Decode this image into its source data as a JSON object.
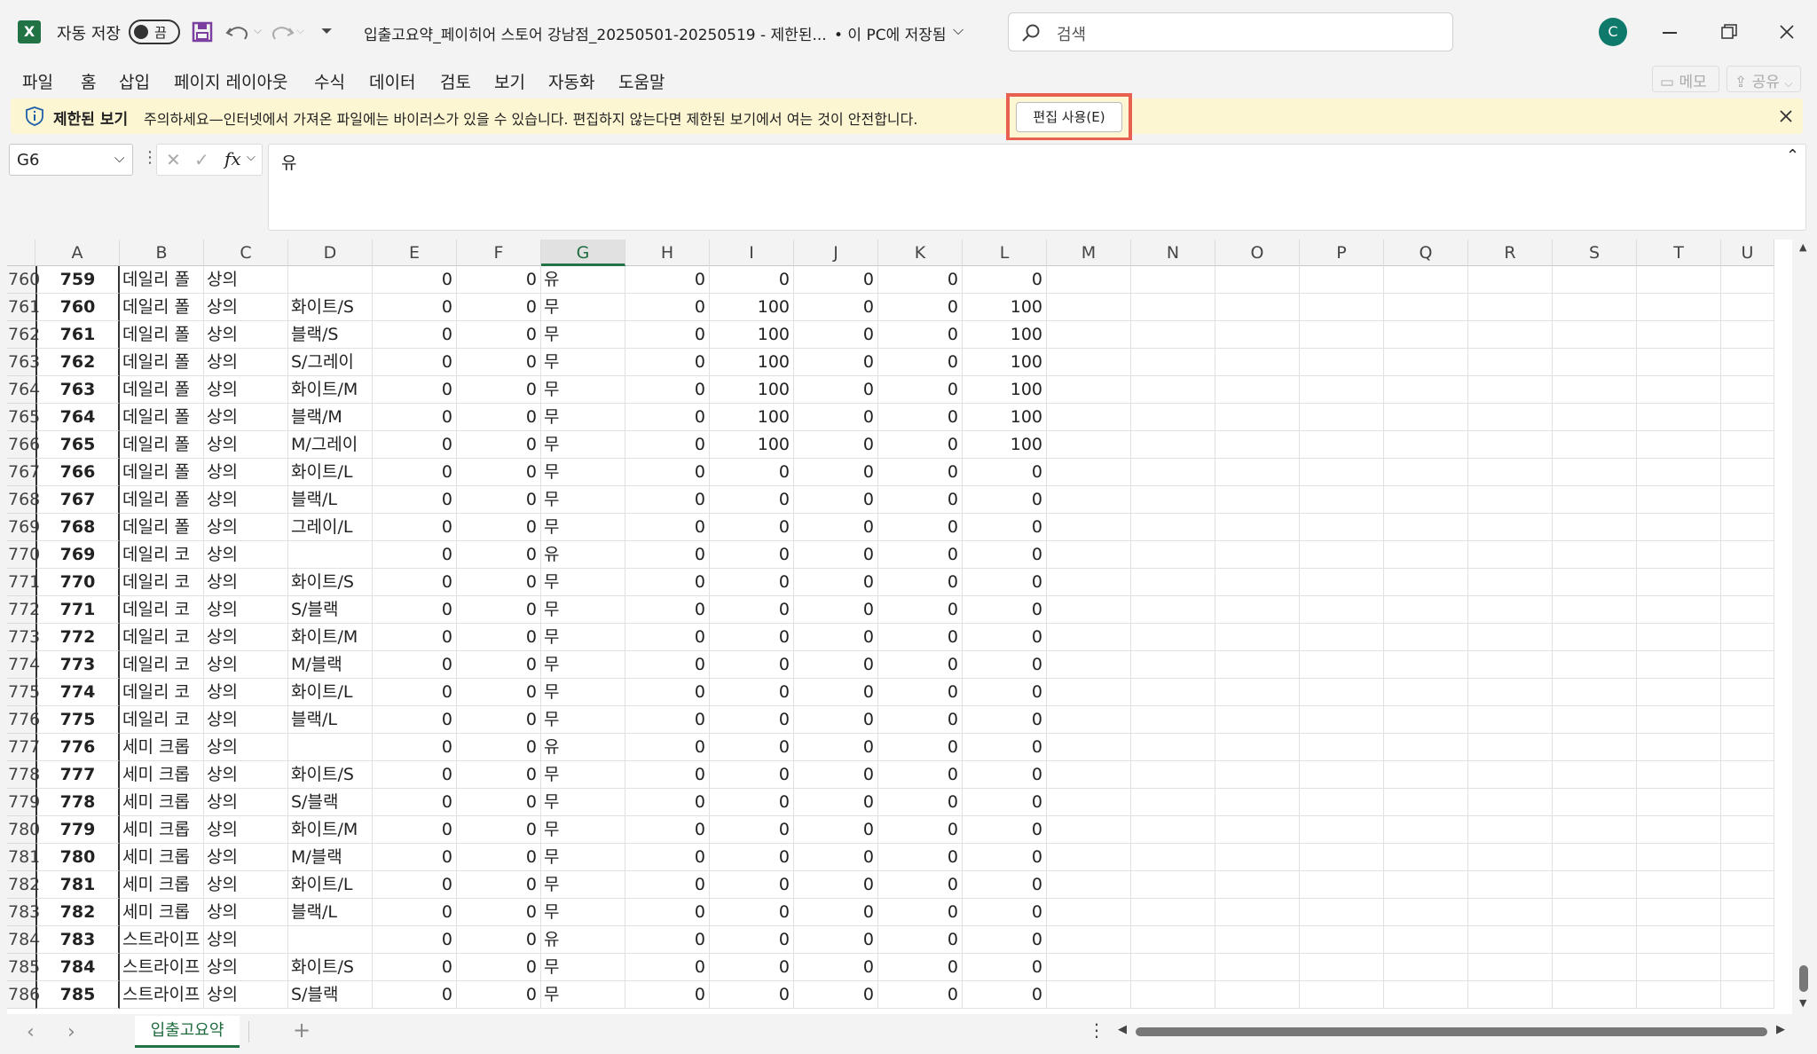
{
  "titlebar": {
    "autosave_label": "자동 저장",
    "autosave_state": "끔",
    "file_title": "입출고요약_페이히어 스토어 강남점_20250501-20250519  -  제한된...",
    "save_location": "• 이 PC에 저장됨",
    "search_placeholder": "검색",
    "avatar_letter": "C"
  },
  "ribbon": {
    "tabs": [
      "파일",
      "홈",
      "삽입",
      "페이지 레이아웃",
      "수식",
      "데이터",
      "검토",
      "보기",
      "자동화",
      "도움말"
    ],
    "memo_label": "메모",
    "share_label": "공유"
  },
  "protected_view": {
    "title": "제한된 보기",
    "message": "주의하세요—인터넷에서 가져온 파일에는 바이러스가 있을 수 있습니다. 편집하지 않는다면 제한된 보기에서 여는 것이 안전합니다.",
    "enable_button": "편집 사용(E)"
  },
  "formula_bar": {
    "name_box": "G6",
    "fx_label": "fx",
    "content": "유"
  },
  "columns": [
    "A",
    "B",
    "C",
    "D",
    "E",
    "F",
    "G",
    "H",
    "I",
    "J",
    "K",
    "L",
    "M",
    "N",
    "O",
    "P",
    "Q",
    "R",
    "S",
    "T",
    "U"
  ],
  "rows": [
    {
      "r": "760",
      "a": "759",
      "b": "데일리 폴",
      "c": "상의",
      "d": "",
      "e": "0",
      "f": "0",
      "g": "유",
      "h": "0",
      "i": "0",
      "j": "0",
      "k": "0",
      "l": "0"
    },
    {
      "r": "761",
      "a": "760",
      "b": "데일리 폴",
      "c": "상의",
      "d": "화이트/S",
      "e": "0",
      "f": "0",
      "g": "무",
      "h": "0",
      "i": "100",
      "j": "0",
      "k": "0",
      "l": "100"
    },
    {
      "r": "762",
      "a": "761",
      "b": "데일리 폴",
      "c": "상의",
      "d": "블랙/S",
      "e": "0",
      "f": "0",
      "g": "무",
      "h": "0",
      "i": "100",
      "j": "0",
      "k": "0",
      "l": "100"
    },
    {
      "r": "763",
      "a": "762",
      "b": "데일리 폴",
      "c": "상의",
      "d": "S/그레이",
      "e": "0",
      "f": "0",
      "g": "무",
      "h": "0",
      "i": "100",
      "j": "0",
      "k": "0",
      "l": "100"
    },
    {
      "r": "764",
      "a": "763",
      "b": "데일리 폴",
      "c": "상의",
      "d": "화이트/M",
      "e": "0",
      "f": "0",
      "g": "무",
      "h": "0",
      "i": "100",
      "j": "0",
      "k": "0",
      "l": "100"
    },
    {
      "r": "765",
      "a": "764",
      "b": "데일리 폴",
      "c": "상의",
      "d": "블랙/M",
      "e": "0",
      "f": "0",
      "g": "무",
      "h": "0",
      "i": "100",
      "j": "0",
      "k": "0",
      "l": "100"
    },
    {
      "r": "766",
      "a": "765",
      "b": "데일리 폴",
      "c": "상의",
      "d": "M/그레이",
      "e": "0",
      "f": "0",
      "g": "무",
      "h": "0",
      "i": "100",
      "j": "0",
      "k": "0",
      "l": "100"
    },
    {
      "r": "767",
      "a": "766",
      "b": "데일리 폴",
      "c": "상의",
      "d": "화이트/L",
      "e": "0",
      "f": "0",
      "g": "무",
      "h": "0",
      "i": "0",
      "j": "0",
      "k": "0",
      "l": "0"
    },
    {
      "r": "768",
      "a": "767",
      "b": "데일리 폴",
      "c": "상의",
      "d": "블랙/L",
      "e": "0",
      "f": "0",
      "g": "무",
      "h": "0",
      "i": "0",
      "j": "0",
      "k": "0",
      "l": "0"
    },
    {
      "r": "769",
      "a": "768",
      "b": "데일리 폴",
      "c": "상의",
      "d": "그레이/L",
      "e": "0",
      "f": "0",
      "g": "무",
      "h": "0",
      "i": "0",
      "j": "0",
      "k": "0",
      "l": "0"
    },
    {
      "r": "770",
      "a": "769",
      "b": "데일리 코",
      "c": "상의",
      "d": "",
      "e": "0",
      "f": "0",
      "g": "유",
      "h": "0",
      "i": "0",
      "j": "0",
      "k": "0",
      "l": "0"
    },
    {
      "r": "771",
      "a": "770",
      "b": "데일리 코",
      "c": "상의",
      "d": "화이트/S",
      "e": "0",
      "f": "0",
      "g": "무",
      "h": "0",
      "i": "0",
      "j": "0",
      "k": "0",
      "l": "0"
    },
    {
      "r": "772",
      "a": "771",
      "b": "데일리 코",
      "c": "상의",
      "d": "S/블랙",
      "e": "0",
      "f": "0",
      "g": "무",
      "h": "0",
      "i": "0",
      "j": "0",
      "k": "0",
      "l": "0"
    },
    {
      "r": "773",
      "a": "772",
      "b": "데일리 코",
      "c": "상의",
      "d": "화이트/M",
      "e": "0",
      "f": "0",
      "g": "무",
      "h": "0",
      "i": "0",
      "j": "0",
      "k": "0",
      "l": "0"
    },
    {
      "r": "774",
      "a": "773",
      "b": "데일리 코",
      "c": "상의",
      "d": "M/블랙",
      "e": "0",
      "f": "0",
      "g": "무",
      "h": "0",
      "i": "0",
      "j": "0",
      "k": "0",
      "l": "0"
    },
    {
      "r": "775",
      "a": "774",
      "b": "데일리 코",
      "c": "상의",
      "d": "화이트/L",
      "e": "0",
      "f": "0",
      "g": "무",
      "h": "0",
      "i": "0",
      "j": "0",
      "k": "0",
      "l": "0"
    },
    {
      "r": "776",
      "a": "775",
      "b": "데일리 코",
      "c": "상의",
      "d": "블랙/L",
      "e": "0",
      "f": "0",
      "g": "무",
      "h": "0",
      "i": "0",
      "j": "0",
      "k": "0",
      "l": "0"
    },
    {
      "r": "777",
      "a": "776",
      "b": "세미 크롭",
      "c": "상의",
      "d": "",
      "e": "0",
      "f": "0",
      "g": "유",
      "h": "0",
      "i": "0",
      "j": "0",
      "k": "0",
      "l": "0"
    },
    {
      "r": "778",
      "a": "777",
      "b": "세미 크롭",
      "c": "상의",
      "d": "화이트/S",
      "e": "0",
      "f": "0",
      "g": "무",
      "h": "0",
      "i": "0",
      "j": "0",
      "k": "0",
      "l": "0"
    },
    {
      "r": "779",
      "a": "778",
      "b": "세미 크롭",
      "c": "상의",
      "d": "S/블랙",
      "e": "0",
      "f": "0",
      "g": "무",
      "h": "0",
      "i": "0",
      "j": "0",
      "k": "0",
      "l": "0"
    },
    {
      "r": "780",
      "a": "779",
      "b": "세미 크롭",
      "c": "상의",
      "d": "화이트/M",
      "e": "0",
      "f": "0",
      "g": "무",
      "h": "0",
      "i": "0",
      "j": "0",
      "k": "0",
      "l": "0"
    },
    {
      "r": "781",
      "a": "780",
      "b": "세미 크롭",
      "c": "상의",
      "d": "M/블랙",
      "e": "0",
      "f": "0",
      "g": "무",
      "h": "0",
      "i": "0",
      "j": "0",
      "k": "0",
      "l": "0"
    },
    {
      "r": "782",
      "a": "781",
      "b": "세미 크롭",
      "c": "상의",
      "d": "화이트/L",
      "e": "0",
      "f": "0",
      "g": "무",
      "h": "0",
      "i": "0",
      "j": "0",
      "k": "0",
      "l": "0"
    },
    {
      "r": "783",
      "a": "782",
      "b": "세미 크롭",
      "c": "상의",
      "d": "블랙/L",
      "e": "0",
      "f": "0",
      "g": "무",
      "h": "0",
      "i": "0",
      "j": "0",
      "k": "0",
      "l": "0"
    },
    {
      "r": "784",
      "a": "783",
      "b": "스트라이프",
      "c": "상의",
      "d": "",
      "e": "0",
      "f": "0",
      "g": "유",
      "h": "0",
      "i": "0",
      "j": "0",
      "k": "0",
      "l": "0"
    },
    {
      "r": "785",
      "a": "784",
      "b": "스트라이프",
      "c": "상의",
      "d": "화이트/S",
      "e": "0",
      "f": "0",
      "g": "무",
      "h": "0",
      "i": "0",
      "j": "0",
      "k": "0",
      "l": "0"
    },
    {
      "r": "786",
      "a": "785",
      "b": "스트라이프",
      "c": "상의",
      "d": "S/블랙",
      "e": "0",
      "f": "0",
      "g": "무",
      "h": "0",
      "i": "0",
      "j": "0",
      "k": "0",
      "l": "0"
    }
  ],
  "sheet_tabs": [
    "입출고요약"
  ],
  "colors": {
    "excel_green": "#217346",
    "highlight": "#e8604f",
    "msgbar": "#fdf6d3",
    "avatar": "#0f7a6b"
  }
}
